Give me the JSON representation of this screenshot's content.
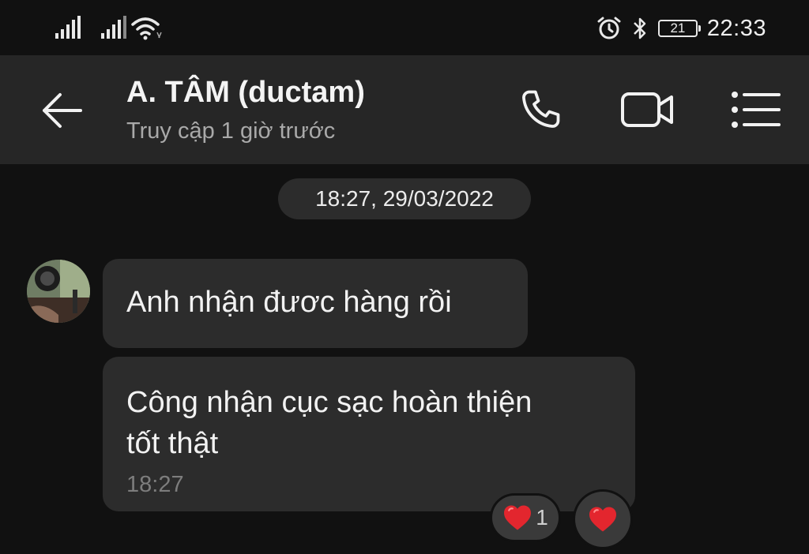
{
  "status_bar": {
    "time": "22:33",
    "battery_level": "21",
    "icons": [
      "signal-icon",
      "signal-icon",
      "wifi-icon",
      "alarm-icon",
      "bluetooth-icon",
      "battery-icon"
    ]
  },
  "header": {
    "title": "A. TÂM (ductam)",
    "subtitle": "Truy cập 1 giờ trước",
    "icons": [
      "back-arrow-icon",
      "phone-icon",
      "video-camera-icon",
      "menu-list-icon"
    ]
  },
  "chat": {
    "date_separator": "18:27, 29/03/2022",
    "messages": [
      {
        "text": "Anh nhận đươc hàng rồi"
      },
      {
        "text_line1": "Công nhận cục sạc hoàn thiện",
        "text_line2": "tốt thật",
        "time": "18:27"
      }
    ],
    "reaction": {
      "emoji": "heart-icon",
      "count": "1"
    },
    "colors": {
      "heart": "#e3262e",
      "bubble": "#2c2c2c",
      "header": "#262626",
      "background": "#111111"
    }
  }
}
